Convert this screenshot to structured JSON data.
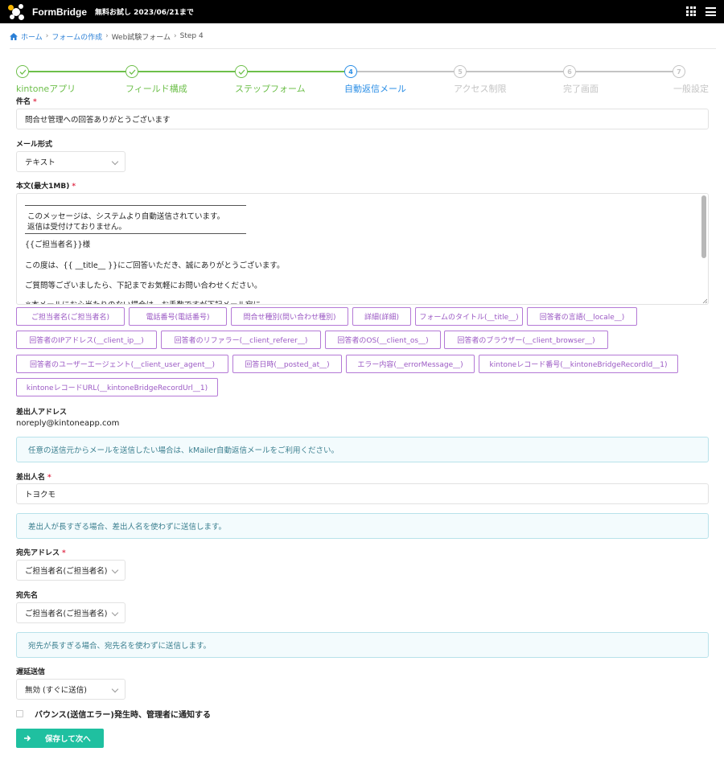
{
  "header": {
    "app_name": "FormBridge",
    "trial": "無料お試し 2023/06/21まで"
  },
  "breadcrumb": {
    "home": "ホーム",
    "create": "フォームの作成",
    "form": "Web試験フォーム",
    "step": "Step 4"
  },
  "steps": [
    {
      "label": "kintoneアプリ",
      "state": "done",
      "mark": ""
    },
    {
      "label": "フィールド構成",
      "state": "done",
      "mark": ""
    },
    {
      "label": "ステップフォーム",
      "state": "done",
      "mark": ""
    },
    {
      "label": "自動返信メール",
      "state": "current",
      "mark": "4"
    },
    {
      "label": "アクセス制限",
      "state": "todo",
      "mark": "5"
    },
    {
      "label": "完了画面",
      "state": "todo",
      "mark": "6"
    },
    {
      "label": "一般設定",
      "state": "todo",
      "mark": "7"
    }
  ],
  "colors": {
    "done": "#6dbf4a",
    "current": "#2a8ee6",
    "todo": "#c4c4c4",
    "accent": "#1fc0a0",
    "chip": "#b479d6"
  },
  "subject": {
    "label": "件名",
    "required": "*",
    "value": "問合せ管理への回答ありがとうございます"
  },
  "mail_format": {
    "label": "メール形式",
    "value": "テキスト"
  },
  "body": {
    "label": "本文(最大1MB)",
    "required": "*",
    "lines": [
      "このメッセージは、システムより自動送信されています。",
      "返信は受付けておりません。",
      "{{ご担当者名}}様",
      "この度は、{{ __title__ }}にご回答いただき、誠にありがとうございます。",
      "ご質問等ございましたら、下記までお気軽にお問い合わせください。",
      "※本メールにお心当たりのない場合は、お手数ですが下記メール宛に"
    ]
  },
  "placeholders": [
    "ご担当者名(ご担当者名)",
    "電話番号(電話番号)",
    "問合せ種別(問い合わせ種別)",
    "詳細(詳細)",
    "フォームのタイトル(__title__)",
    "回答者の言語(__locale__)",
    "回答者のIPアドレス(__client_ip__)",
    "回答者のリファラー(__client_referer__)",
    "回答者のOS(__client_os__)",
    "回答者のブラウザー(__client_browser__)",
    "回答者のユーザーエージェント(__client_user_agent__)",
    "回答日時(__posted_at__)",
    "エラー内容(__errorMessage__)",
    "kintoneレコード番号(__kintoneBridgeRecordId__1)",
    "kintoneレコードURL(__kintoneBridgeRecordUrl__1)"
  ],
  "sender_address": {
    "label": "差出人アドレス",
    "value": "noreply@kintoneapp.com",
    "info": "任意の送信元からメールを送信したい場合は、kMailer自動返信メールをご利用ください。"
  },
  "sender_name": {
    "label": "差出人名",
    "required": "*",
    "value": "トヨクモ",
    "info": "差出人が長すぎる場合、差出人名を使わずに送信します。"
  },
  "to_address": {
    "label": "宛先アドレス",
    "required": "*",
    "value": "ご担当者名(ご担当者名)"
  },
  "to_name": {
    "label": "宛先名",
    "value": "ご担当者名(ご担当者名)",
    "info": "宛先が長すぎる場合、宛先名を使わずに送信します。"
  },
  "delay": {
    "label": "遅延送信",
    "value": "無効 (すぐに送信)"
  },
  "bounce_notify": {
    "label": "バウンス(送信エラー)発生時、管理者に通知する",
    "checked": false
  },
  "save_button": {
    "label": "保存して次へ"
  }
}
